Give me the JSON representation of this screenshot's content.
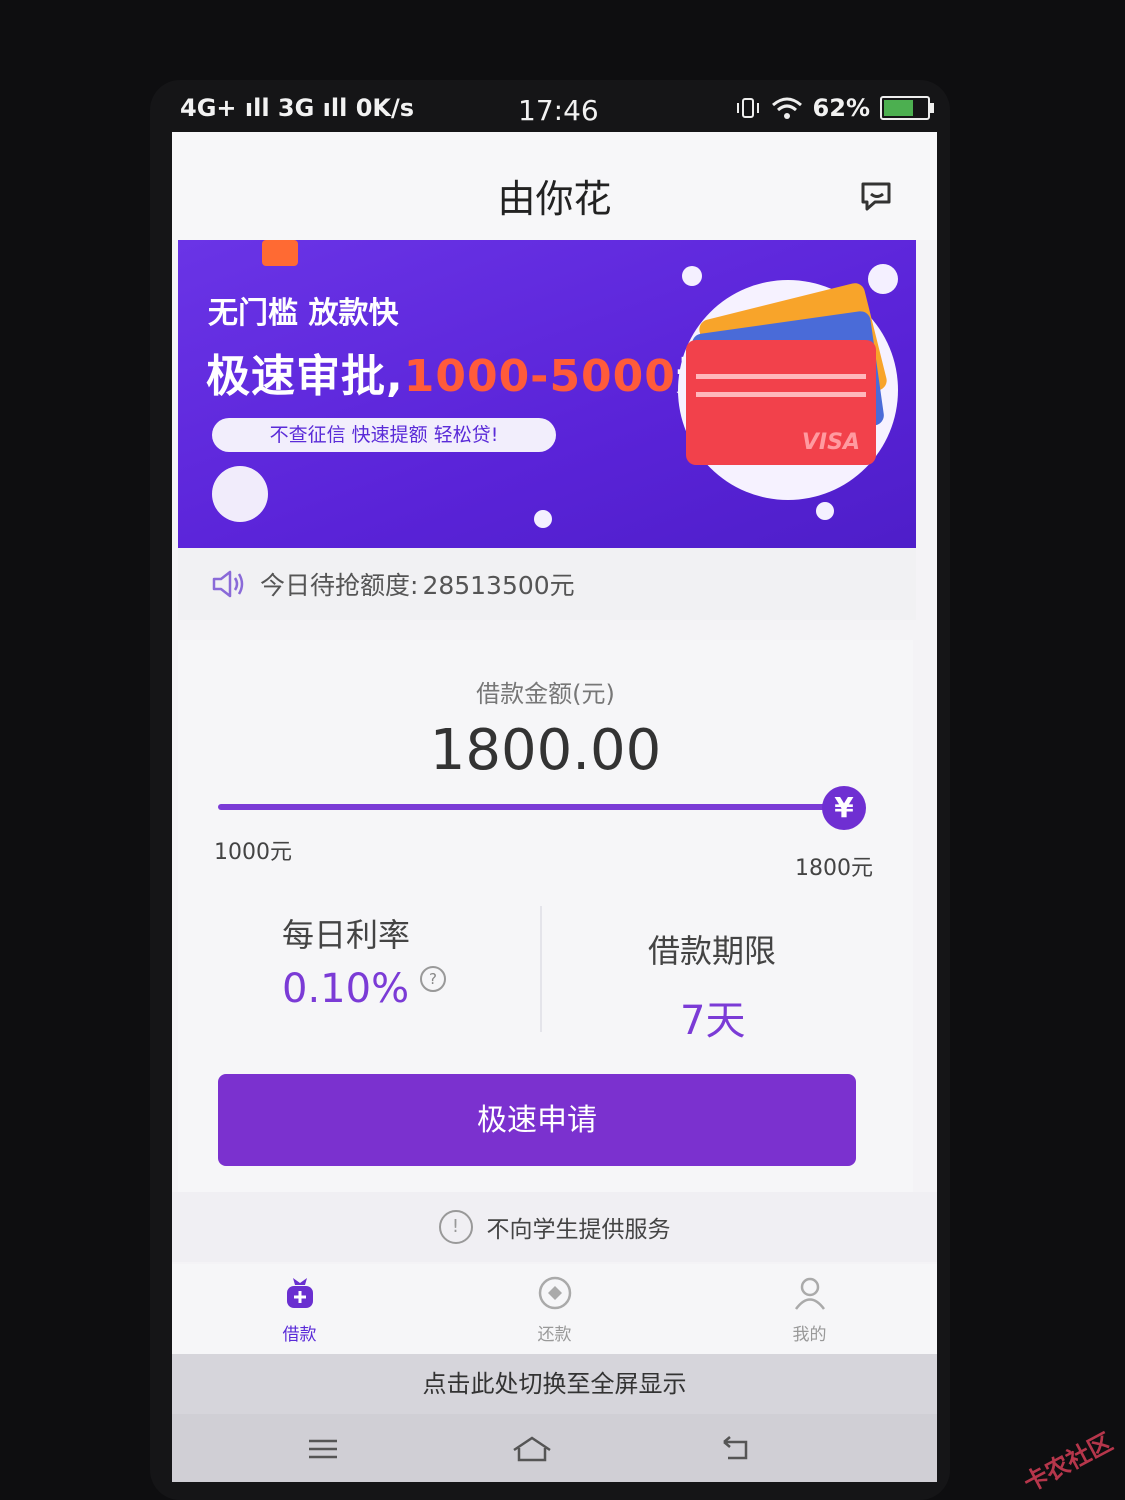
{
  "status_bar": {
    "network": "4G+ ıll 3G ıll 0K/s",
    "time": "17:46",
    "battery_percent": "62%"
  },
  "header": {
    "title": "由你花",
    "message_icon": "chat-icon"
  },
  "banner": {
    "line1": "无门槛 放款快",
    "line2_prefix": "极速审批,",
    "line2_highlight": "1000-5000",
    "line2_suffix": "元",
    "pill_text": "不查征信 快速提额 轻松贷!",
    "card_brand": "VISA"
  },
  "notice": {
    "label": "今日待抢额度:",
    "value": "28513500元"
  },
  "loan": {
    "amount_label": "借款金额(元)",
    "amount": "1800.00",
    "slider_min_label": "1000元",
    "slider_max_label": "1800元",
    "slider_knob": "¥",
    "slider_fraction": 1.0,
    "rate_label": "每日利率",
    "rate_value": "0.10%",
    "rate_help": "?",
    "term_label": "借款期限",
    "term_value": "7天"
  },
  "apply_button": "极速申请",
  "student_note": {
    "icon": "!",
    "text": "不向学生提供服务"
  },
  "tabs": [
    {
      "label": "借款",
      "icon": "loan-bag-icon",
      "active": true
    },
    {
      "label": "还款",
      "icon": "repay-icon",
      "active": false
    },
    {
      "label": "我的",
      "icon": "user-icon",
      "active": false
    }
  ],
  "fullscreen_prompt": "点击此处切换至全屏显示",
  "colors": {
    "accent": "#7b31cf",
    "banner": "#5a23d8",
    "highlight": "#ff5b3a"
  },
  "watermark": "卡农社区"
}
